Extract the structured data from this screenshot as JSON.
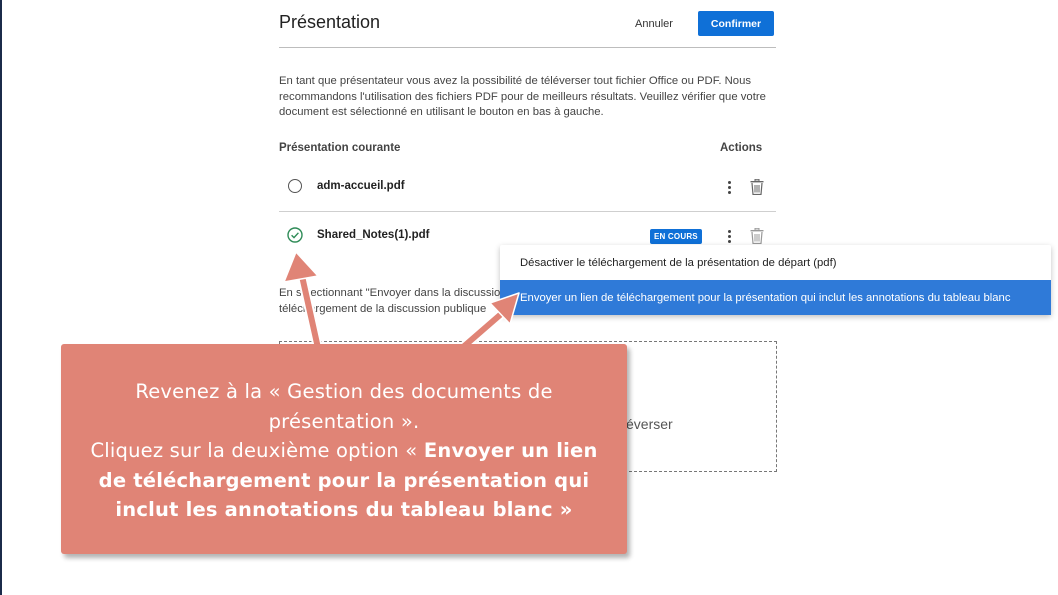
{
  "header": {
    "title": "Présentation",
    "cancel_label": "Annuler",
    "confirm_label": "Confirmer"
  },
  "description": "En tant que présentateur vous avez la possibilité de téléverser tout fichier Office ou PDF. Nous recommandons l'utilisation des fichiers PDF pour de meilleurs résultats. Veuillez vérifier que votre document est sélectionné en utilisant le bouton en bas à gauche.",
  "table": {
    "col_current": "Présentation courante",
    "col_actions": "Actions",
    "rows": [
      {
        "name": "adm-accueil.pdf",
        "selected": false
      },
      {
        "name": "Shared_Notes(1).pdf",
        "selected": true,
        "badge": "EN COURS"
      }
    ]
  },
  "below_text": {
    "line1": "En sélectionnant \"Envoyer dans la discussion",
    "line2": "téléchargement de la discussion publique"
  },
  "dropzone": {
    "label": "éverser"
  },
  "context_menu": {
    "items": [
      {
        "label": "Désactiver le téléchargement de la présentation de départ (pdf)",
        "highlighted": false
      },
      {
        "label": "Envoyer un lien de téléchargement pour la présentation qui inclut les annotations du tableau blanc",
        "highlighted": true
      }
    ]
  },
  "callout": {
    "line1": "Revenez à la « Gestion des documents de",
    "line2": "présentation ».",
    "line3_normal": "Cliquez sur la deuxième option « ",
    "line3_bold": "Envoyer un lien",
    "line4": "de téléchargement pour la présentation qui",
    "line5": "inclut les annotations du tableau blanc »"
  },
  "colors": {
    "accent": "#0f70d7",
    "menu_highlight": "#2f7ad8",
    "callout_bg": "#e08476",
    "check": "#2e8b57"
  }
}
